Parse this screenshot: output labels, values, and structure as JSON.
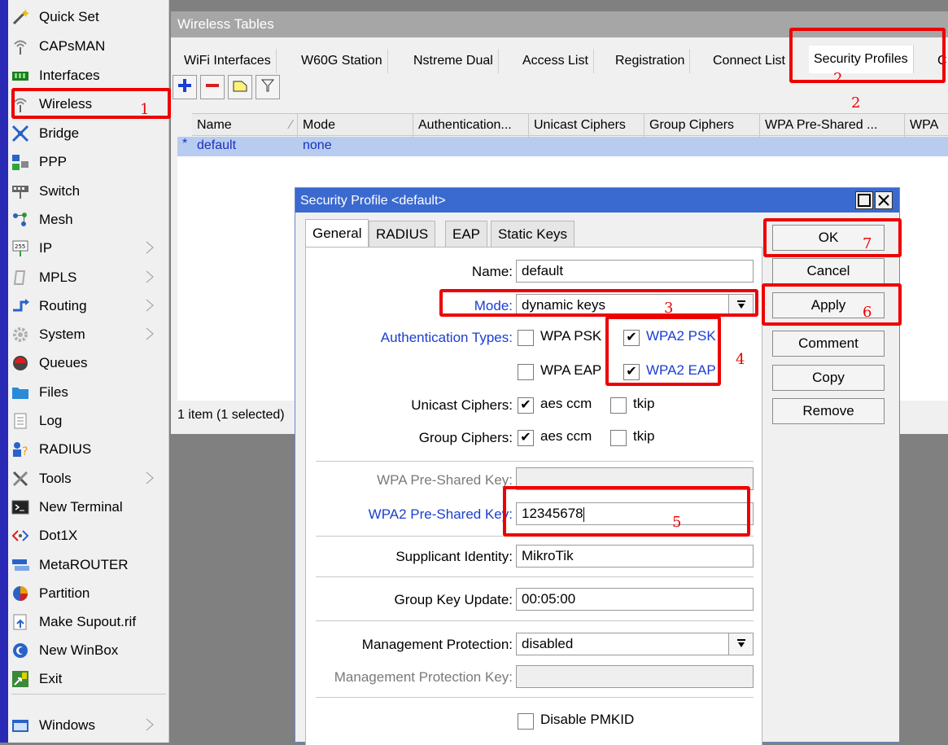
{
  "sidebar": {
    "items": [
      {
        "label": "Quick Set",
        "icon": "wand-icon",
        "submenu": false
      },
      {
        "label": "CAPsMAN",
        "icon": "antenna-icon",
        "submenu": false
      },
      {
        "label": "Interfaces",
        "icon": "interfaces-icon",
        "submenu": false
      },
      {
        "label": "Wireless",
        "icon": "antenna-icon",
        "submenu": false
      },
      {
        "label": "Bridge",
        "icon": "bridge-icon",
        "submenu": false
      },
      {
        "label": "PPP",
        "icon": "ppp-icon",
        "submenu": false
      },
      {
        "label": "Switch",
        "icon": "switch-icon",
        "submenu": false
      },
      {
        "label": "Mesh",
        "icon": "mesh-icon",
        "submenu": false
      },
      {
        "label": "IP",
        "icon": "ip-icon",
        "submenu": true
      },
      {
        "label": "MPLS",
        "icon": "mpls-icon",
        "submenu": true
      },
      {
        "label": "Routing",
        "icon": "routing-icon",
        "submenu": true
      },
      {
        "label": "System",
        "icon": "gear-icon",
        "submenu": true
      },
      {
        "label": "Queues",
        "icon": "queues-icon",
        "submenu": false
      },
      {
        "label": "Files",
        "icon": "folder-icon",
        "submenu": false
      },
      {
        "label": "Log",
        "icon": "log-icon",
        "submenu": false
      },
      {
        "label": "RADIUS",
        "icon": "users-icon",
        "submenu": false
      },
      {
        "label": "Tools",
        "icon": "tools-icon",
        "submenu": true
      },
      {
        "label": "New Terminal",
        "icon": "terminal-icon",
        "submenu": false
      },
      {
        "label": "Dot1X",
        "icon": "dot1x-icon",
        "submenu": false
      },
      {
        "label": "MetaROUTER",
        "icon": "metarouter-icon",
        "submenu": false
      },
      {
        "label": "Partition",
        "icon": "pie-icon",
        "submenu": false
      },
      {
        "label": "Make Supout.rif",
        "icon": "supout-icon",
        "submenu": false
      },
      {
        "label": "New WinBox",
        "icon": "winbox-icon",
        "submenu": false
      },
      {
        "label": "Exit",
        "icon": "exit-icon",
        "submenu": false
      }
    ],
    "windows": {
      "label": "Windows",
      "icon": "windows-icon",
      "submenu": true
    }
  },
  "wireless_tables": {
    "title": "Wireless Tables",
    "tabs": [
      "WiFi Interfaces",
      "W60G Station",
      "Nstreme Dual",
      "Access List",
      "Registration",
      "Connect List",
      "Security Profiles",
      "C"
    ],
    "toolbar": [
      "add-icon",
      "remove-icon",
      "comment-icon",
      "filter-icon"
    ],
    "columns": [
      "Name",
      "Mode",
      "Authentication...",
      "Unicast Ciphers",
      "Group Ciphers",
      "WPA Pre-Shared ...",
      "WPA"
    ],
    "rows": [
      {
        "marker": "*",
        "name": "default",
        "mode": "none"
      }
    ],
    "status": "1 item (1 selected)"
  },
  "dialog": {
    "title": "Security Profile <default>",
    "tabs": [
      "General",
      "RADIUS",
      "EAP",
      "Static Keys"
    ],
    "active_tab": "General",
    "fields": {
      "name": {
        "label": "Name:",
        "value": "default"
      },
      "mode": {
        "label": "Mode:",
        "value": "dynamic keys"
      },
      "auth_types": {
        "label": "Authentication Types:",
        "options": [
          {
            "label": "WPA PSK",
            "checked": false
          },
          {
            "label": "WPA2 PSK",
            "checked": true
          },
          {
            "label": "WPA EAP",
            "checked": false
          },
          {
            "label": "WPA2 EAP",
            "checked": true
          }
        ]
      },
      "unicast_ciphers": {
        "label": "Unicast Ciphers:",
        "options": [
          {
            "label": "aes ccm",
            "checked": true
          },
          {
            "label": "tkip",
            "checked": false
          }
        ]
      },
      "group_ciphers": {
        "label": "Group Ciphers:",
        "options": [
          {
            "label": "aes ccm",
            "checked": true
          },
          {
            "label": "tkip",
            "checked": false
          }
        ]
      },
      "wpa_key": {
        "label": "WPA Pre-Shared Key:",
        "value": ""
      },
      "wpa2_key": {
        "label": "WPA2 Pre-Shared Key:",
        "value": "12345678"
      },
      "supplicant": {
        "label": "Supplicant Identity:",
        "value": "MikroTik"
      },
      "group_key_update": {
        "label": "Group Key Update:",
        "value": "00:05:00"
      },
      "mgmt_protection": {
        "label": "Management Protection:",
        "value": "disabled"
      },
      "mgmt_key": {
        "label": "Management Protection Key:",
        "value": ""
      },
      "disable_pmkid": {
        "label": "Disable PMKID",
        "checked": false
      }
    },
    "buttons": [
      "OK",
      "Cancel",
      "Apply",
      "Comment",
      "Copy",
      "Remove"
    ]
  },
  "annotations": [
    "1",
    "2",
    "2",
    "3",
    "4",
    "5",
    "6",
    "7"
  ],
  "colors": {
    "selection": "#b8ccf0",
    "title_active": "#3a6ad0",
    "link_blue": "#1a3fd0",
    "annotation_red": "#ee0000"
  }
}
